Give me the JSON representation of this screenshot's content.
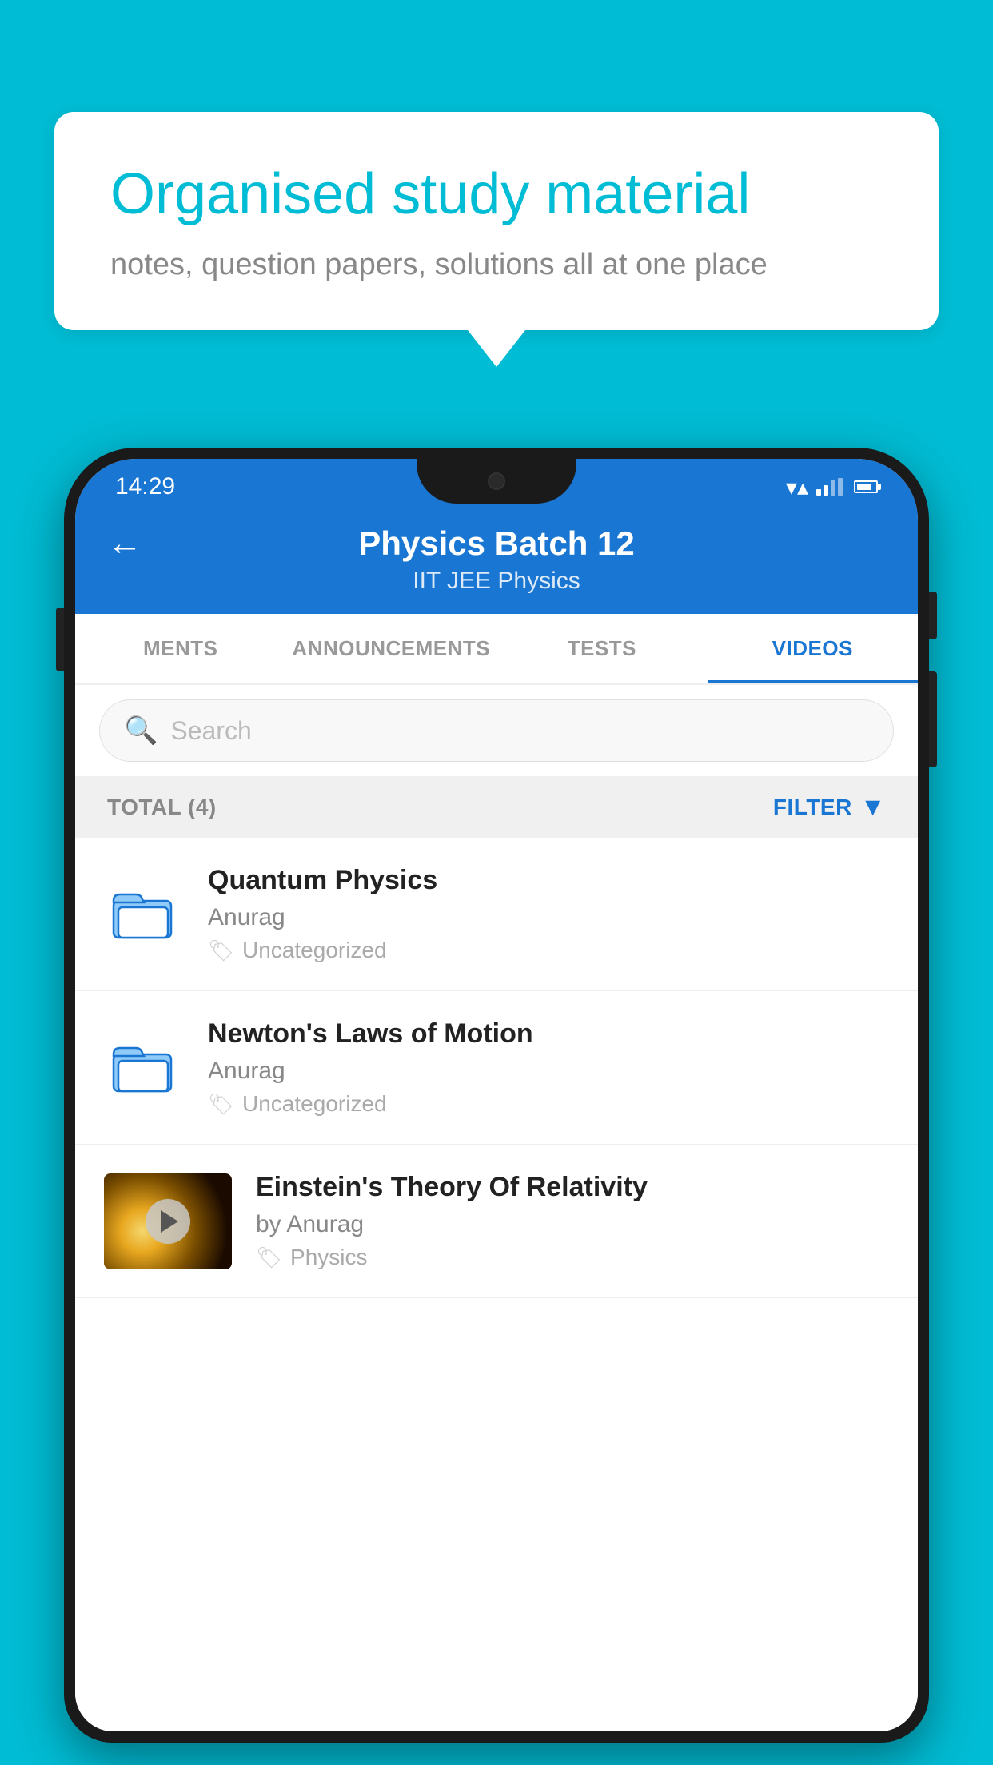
{
  "background": {
    "color": "#00BCD4"
  },
  "speech_bubble": {
    "title": "Organised study material",
    "subtitle": "notes, question papers, solutions all at one place"
  },
  "phone": {
    "status_bar": {
      "time": "14:29"
    },
    "header": {
      "title": "Physics Batch 12",
      "subtitle_tags": "IIT JEE   Physics",
      "back_label": "←"
    },
    "tabs": [
      {
        "label": "MENTS",
        "active": false
      },
      {
        "label": "ANNOUNCEMENTS",
        "active": false
      },
      {
        "label": "TESTS",
        "active": false
      },
      {
        "label": "VIDEOS",
        "active": true
      }
    ],
    "search": {
      "placeholder": "Search"
    },
    "filter_bar": {
      "total_label": "TOTAL (4)",
      "filter_label": "FILTER"
    },
    "videos": [
      {
        "id": 1,
        "title": "Quantum Physics",
        "author": "Anurag",
        "tag": "Uncategorized",
        "type": "folder",
        "has_thumb": false
      },
      {
        "id": 2,
        "title": "Newton's Laws of Motion",
        "author": "Anurag",
        "tag": "Uncategorized",
        "type": "folder",
        "has_thumb": false
      },
      {
        "id": 3,
        "title": "Einstein's Theory Of Relativity",
        "author": "by Anurag",
        "tag": "Physics",
        "type": "video",
        "has_thumb": true
      }
    ]
  }
}
